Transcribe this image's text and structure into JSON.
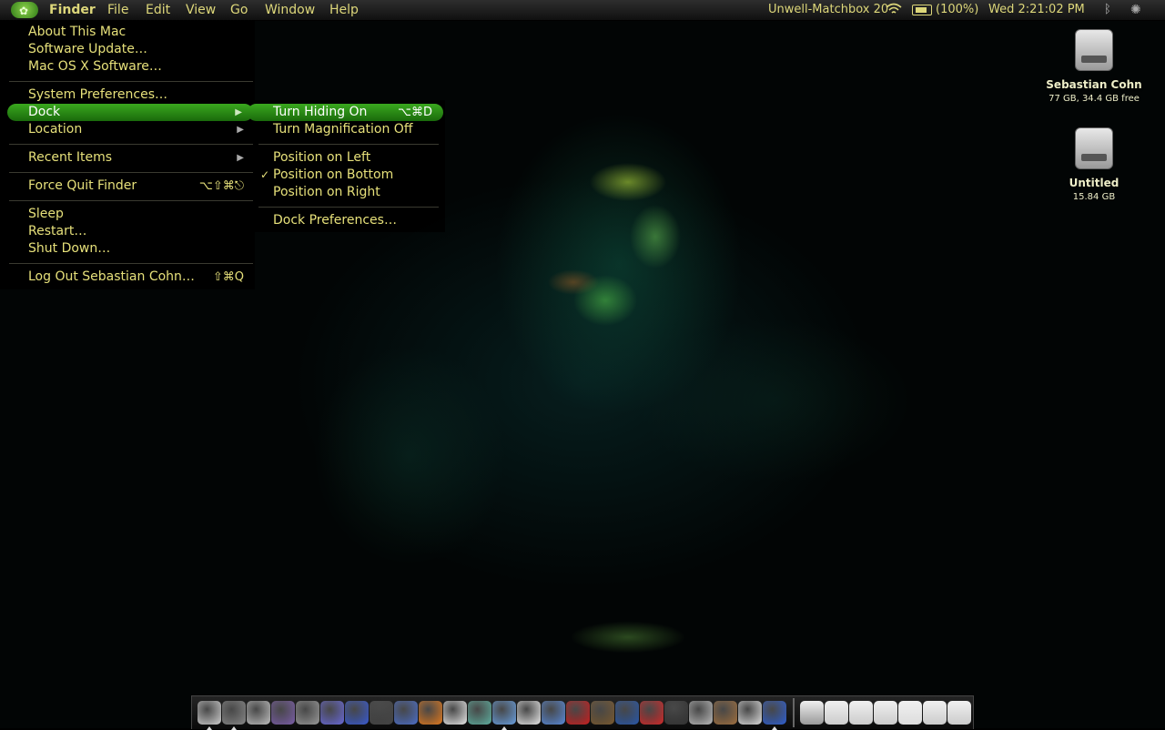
{
  "menubar": {
    "menus": [
      "Finder",
      "File",
      "Edit",
      "View",
      "Go",
      "Window",
      "Help"
    ],
    "network": "Unwell-Matchbox 20",
    "battery": "(100%)",
    "clock": "Wed 2:21:02 PM"
  },
  "apple_menu": {
    "about": "About This Mac",
    "software_update": "Software Update…",
    "mac_software": "Mac OS X Software…",
    "system_prefs": "System Preferences…",
    "dock": "Dock",
    "location": "Location",
    "recent_items": "Recent Items",
    "force_quit": "Force Quit Finder",
    "force_quit_shortcut": "⌥⇧⌘⎋",
    "sleep": "Sleep",
    "restart": "Restart…",
    "shut_down": "Shut Down…",
    "log_out": "Log Out Sebastian Cohn…",
    "log_out_shortcut": "⇧⌘Q"
  },
  "dock_submenu": {
    "hiding": "Turn Hiding On",
    "hiding_shortcut": "⌥⌘D",
    "magnification": "Turn Magnification Off",
    "pos_left": "Position on Left",
    "pos_bottom": "Position on Bottom",
    "pos_right": "Position on Right",
    "prefs": "Dock Preferences…",
    "checked": "pos_bottom"
  },
  "desktop": {
    "drives": [
      {
        "name": "Sebastian Cohn",
        "info": "77 GB, 34.4 GB free"
      },
      {
        "name": "Untitled",
        "info": "15.84 GB"
      }
    ]
  },
  "dock_items": {
    "apps": [
      "finder",
      "dashboard",
      "system-preferences",
      "itunes-like",
      "spotlight",
      "xcode",
      "blitzmax",
      "game",
      "unreal",
      "firefox",
      "chat",
      "egg",
      "itunes",
      "ical",
      "preview",
      "photo-booth",
      "iphoto",
      "google-earth",
      "pin",
      "clapper",
      "sync",
      "wood",
      "pen",
      "safari"
    ],
    "docs": [
      "hard-drive",
      "downloads",
      "no-entry",
      "folder",
      "document",
      "calendar-doc",
      "trash"
    ],
    "colors": [
      "#cfcfcf",
      "#888",
      "#c0c0c0",
      "#7b5ea8",
      "#999",
      "#6a6ad8",
      "#3a5bd0",
      "#444",
      "#4d6fc8",
      "#e07a20",
      "#e8e8e8",
      "#60b0a0",
      "#6aa0e0",
      "#e8e8e8",
      "#5a8ad8",
      "#c82020",
      "#7a5a30",
      "#2a58a8",
      "#d02a2a",
      "#333",
      "#bbb",
      "#a07040",
      "#ddd",
      "#3060d0"
    ],
    "doc_colors": [
      "#999",
      "#ccc",
      "#ccc",
      "#ccc",
      "#ddd",
      "#ccc",
      "#ccc"
    ],
    "running": [
      0,
      1,
      12,
      23
    ]
  }
}
